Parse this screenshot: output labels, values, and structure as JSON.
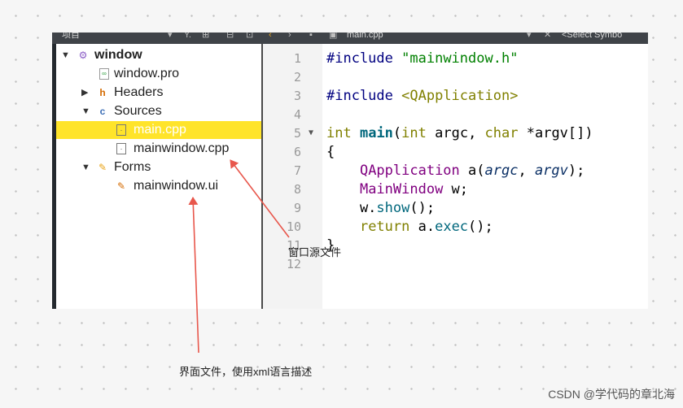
{
  "toolbar": {
    "pane_title": "项目",
    "file_tab": "main.cpp",
    "symbol_box": "<Select Symbo"
  },
  "tree": [
    {
      "label": "window",
      "arrow": "▼",
      "icon": "project-icon",
      "bold": true
    },
    {
      "label": "window.pro",
      "icon": "pro-file-icon"
    },
    {
      "label": "Headers",
      "arrow": "▶",
      "icon": "headers-folder-icon"
    },
    {
      "label": "Sources",
      "arrow": "▼",
      "icon": "sources-folder-icon"
    },
    {
      "label": "main.cpp",
      "icon": "cpp-file-icon",
      "selected": true
    },
    {
      "label": "mainwindow.cpp",
      "icon": "cpp-file-icon"
    },
    {
      "label": "Forms",
      "arrow": "▼",
      "icon": "forms-folder-icon"
    },
    {
      "label": "mainwindow.ui",
      "icon": "ui-file-icon"
    }
  ],
  "editor": {
    "line_numbers": [
      "1",
      "2",
      "3",
      "4",
      "5",
      "6",
      "7",
      "8",
      "9",
      "10",
      "11",
      "12"
    ],
    "lines": [
      "#include \"mainwindow.h\"",
      "",
      "#include <QApplication>",
      "",
      "int main(int argc, char *argv[])",
      "{",
      "    QApplication a(argc, argv);",
      "    MainWindow w;",
      "    w.show();",
      "    return a.exec();",
      "}",
      ""
    ]
  },
  "annotations": {
    "window_source": "窗口源文件",
    "ui_file": "界面文件，使用xml语言描述"
  },
  "watermark": "CSDN @学代码的章北海",
  "colors": {
    "selection": "#ffe42a",
    "arrow": "#e8574c",
    "toolbar": "#3f4348"
  }
}
